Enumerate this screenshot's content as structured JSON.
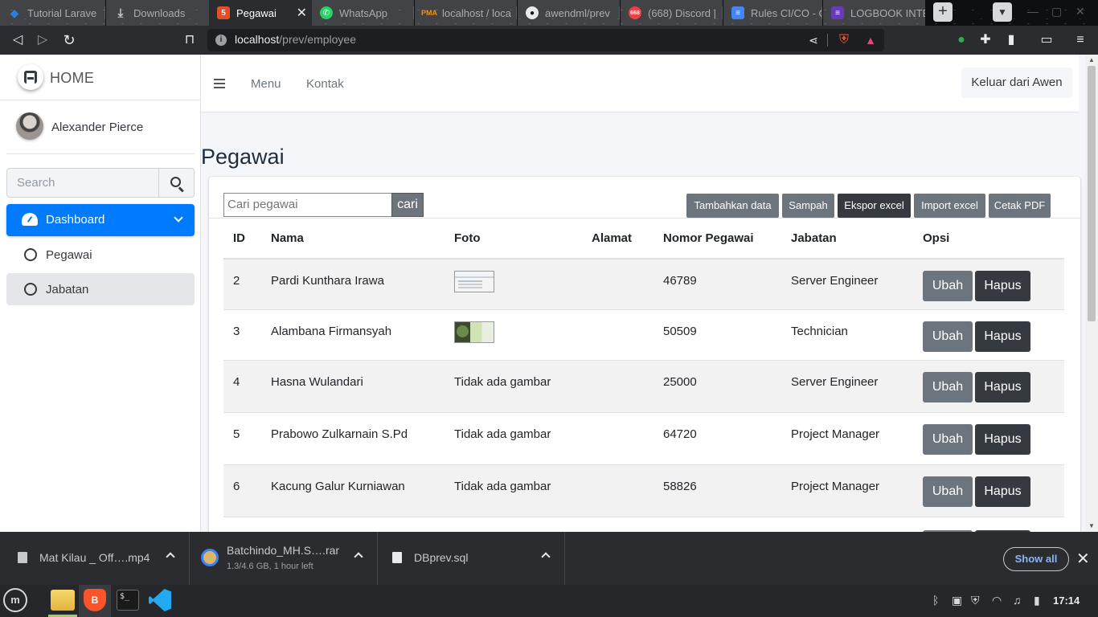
{
  "browser": {
    "tabs": [
      {
        "label": "Tutorial Larave",
        "icon": "code-icon",
        "color": "#2f7de1"
      },
      {
        "label": "Downloads",
        "icon": "download-icon",
        "color": "#c6c9cd"
      },
      {
        "label": "Pegawai",
        "icon": "html-icon",
        "color": "#e44d26",
        "active": true
      },
      {
        "label": "WhatsApp",
        "icon": "whatsapp-icon",
        "color": "#25d366"
      },
      {
        "label": "localhost / loca",
        "icon": "phpmyadmin-icon",
        "color": "#f29111"
      },
      {
        "label": "awendml/prev",
        "icon": "github-icon",
        "color": "#e8eaed"
      },
      {
        "label": "(668) Discord |",
        "icon": "discord-icon",
        "color": "#5865f2",
        "badge": "668"
      },
      {
        "label": "Rules CI/CO - G",
        "icon": "docs-icon",
        "color": "#4285f4"
      },
      {
        "label": "LOGBOOK INTE",
        "icon": "forms-icon",
        "color": "#673ab7"
      }
    ],
    "url_host": "localhost",
    "url_path": "/prev/employee"
  },
  "sidebar": {
    "brand": "HOME",
    "user_name": "Alexander Pierce",
    "search_placeholder": "Search",
    "nav": {
      "dashboard": "Dashboard",
      "items": [
        {
          "label": "Pegawai",
          "active": false
        },
        {
          "label": "Jabatan",
          "active": true
        }
      ]
    }
  },
  "topnav": {
    "links": [
      "Menu",
      "Kontak"
    ],
    "logout": "Keluar dari Awen"
  },
  "main": {
    "title": "Pegawai",
    "search_placeholder": "Cari pegawai",
    "search_button": "cari",
    "actions": [
      "Tambahkan data",
      "Sampah",
      "Ekspor excel",
      "Import excel",
      "Cetak PDF"
    ],
    "table": {
      "headers": [
        "ID",
        "Nama",
        "Foto",
        "Alamat",
        "Nomor Pegawai",
        "Jabatan",
        "Opsi"
      ],
      "rows": [
        {
          "id": "2",
          "nama": "Pardi Kunthara Irawa",
          "foto": "image",
          "alamat": "",
          "nomor": "46789",
          "jabatan": "Server Engineer"
        },
        {
          "id": "3",
          "nama": "Alambana Firmansyah",
          "foto": "image",
          "alamat": "",
          "nomor": "50509",
          "jabatan": "Technician"
        },
        {
          "id": "4",
          "nama": "Hasna Wulandari",
          "foto": "Tidak ada gambar",
          "alamat": "",
          "nomor": "25000",
          "jabatan": "Server Engineer"
        },
        {
          "id": "5",
          "nama": "Prabowo Zulkarnain S.Pd",
          "foto": "Tidak ada gambar",
          "alamat": "",
          "nomor": "64720",
          "jabatan": "Project Manager"
        },
        {
          "id": "6",
          "nama": "Kacung Galur Kurniawan",
          "foto": "Tidak ada gambar",
          "alamat": "",
          "nomor": "58826",
          "jabatan": "Project Manager"
        }
      ],
      "edit_label": "Ubah",
      "delete_label": "Hapus"
    }
  },
  "downloads": {
    "items": [
      {
        "name": "Mat Kilau _ Off….mp4",
        "sub": ""
      },
      {
        "name": "Batchindo_MH.S….rar",
        "sub": "1.3/4.6 GB, 1 hour left"
      },
      {
        "name": "DBprev.sql",
        "sub": ""
      }
    ],
    "show_all": "Show all"
  },
  "taskbar": {
    "clock": "17:14"
  },
  "colors": {
    "primary": "#007bff",
    "secondary": "#6c757d",
    "dark": "#343a40"
  }
}
